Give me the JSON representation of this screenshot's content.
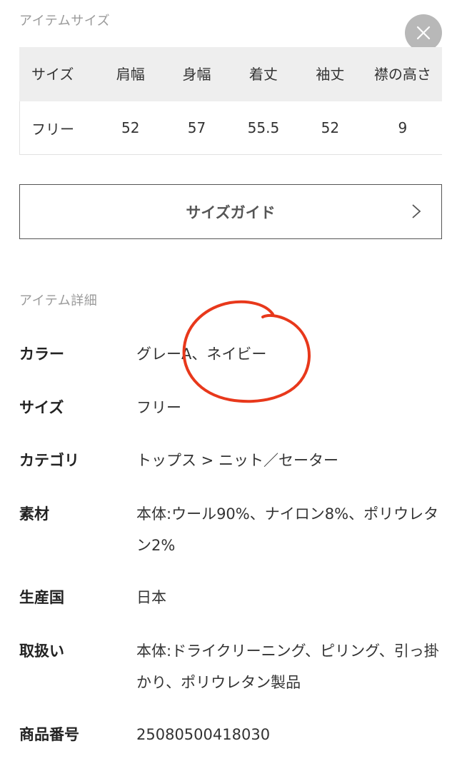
{
  "item_size": {
    "title": "アイテムサイズ",
    "headers": [
      "サイズ",
      "肩幅",
      "身幅",
      "着丈",
      "袖丈",
      "襟の高さ"
    ],
    "rows": [
      [
        "フリー",
        "52",
        "57",
        "55.5",
        "52",
        "9"
      ]
    ]
  },
  "close_icon": "close-icon",
  "size_guide": {
    "label": "サイズガイド",
    "icon": "chevron-right-icon"
  },
  "item_detail": {
    "title": "アイテム詳細",
    "rows": [
      {
        "label": "カラー",
        "value": "グレーA、ネイビー"
      },
      {
        "label": "サイズ",
        "value": "フリー"
      },
      {
        "label": "カテゴリ",
        "value": "トップス > ニット／セーター"
      },
      {
        "label": "素材",
        "value": "本体:ウール90%、ナイロン8%、ポリウレタン2%"
      },
      {
        "label": "生産国",
        "value": "日本"
      },
      {
        "label": "取扱い",
        "value": "本体:ドライクリーニング、ピリング、引っ掛かり、ポリウレタン製品"
      },
      {
        "label": "商品番号",
        "value": "25080500418030"
      }
    ]
  },
  "colors": {
    "annotation": "#e8381b",
    "header_bg": "#eeeeee",
    "close_bg": "#b8b8b8"
  }
}
